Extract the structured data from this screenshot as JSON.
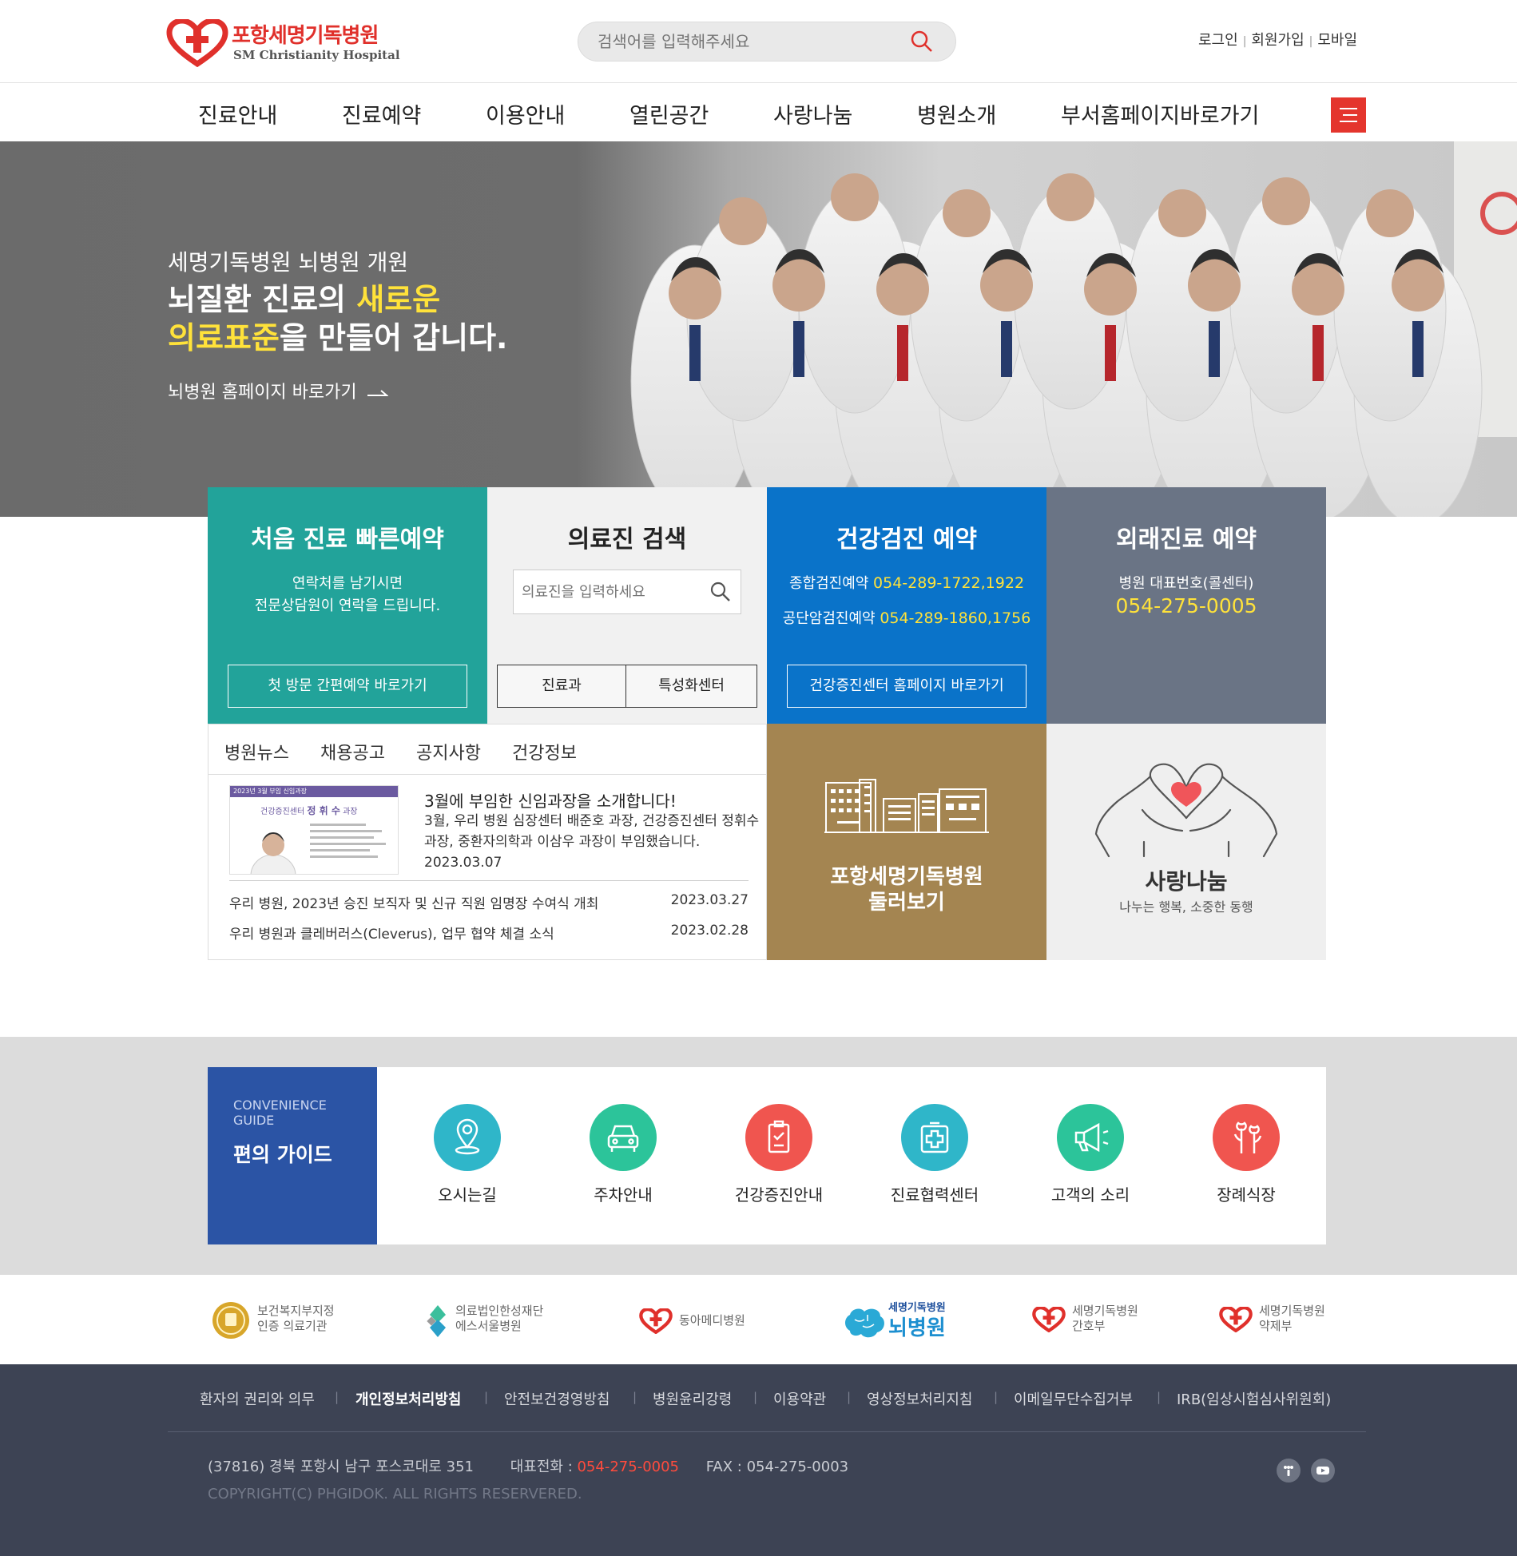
{
  "header": {
    "logo_kr": "포항세명기독병원",
    "logo_en": "SM Christianity Hospital",
    "search_placeholder": "검색어를 입력해주세요",
    "util": [
      "로그인",
      "회원가입",
      "모바일"
    ]
  },
  "nav": {
    "items": [
      "진료안내",
      "진료예약",
      "이용안내",
      "열린공간",
      "사랑나눔",
      "병원소개",
      "부서홈페이지바로가기"
    ]
  },
  "hero": {
    "subtitle": "세명기독병원 뇌병원 개원",
    "line1_a": "뇌질환 진료의 ",
    "line1_hl": "새로운",
    "line2_hl": "의료표준",
    "line2_b": "을 만들어 갑니다.",
    "link": "뇌병원 홈페이지 바로가기"
  },
  "quick": {
    "first_visit": {
      "title": "처음 진료 빠른예약",
      "text1": "연락처를 남기시면",
      "text2": "전문상담원이 연락을 드립니다.",
      "button": "첫 방문 간편예약 바로가기"
    },
    "doctor_search": {
      "title": "의료진 검색",
      "placeholder": "의료진을 입력하세요",
      "tab1": "진료과",
      "tab2": "특성화센터"
    },
    "checkup": {
      "title": "건강검진 예약",
      "row1_label": "종합검진예약 ",
      "row1_num": "054-289-1722,1922",
      "row2_label": "공단암검진예약 ",
      "row2_num": "054-289-1860,1756",
      "button": "건강증진센터 홈페이지 바로가기"
    },
    "outpatient": {
      "title": "외래진료 예약",
      "label": "병원 대표번호(콜센터)",
      "phone": "054-275-0005"
    }
  },
  "news": {
    "tabs": [
      "병원뉴스",
      "채용공고",
      "공지사항",
      "건강정보"
    ],
    "thumb_header": "2023년 3월 부임 신임과장",
    "thumb_dept": "건강증진센터",
    "thumb_name": "정 휘 수",
    "thumb_role": "과장",
    "featured_title": "3월에 부임한 신임과장을 소개합니다!",
    "featured_body": "3월, 우리 병원 심장센터 배준호 과장, 건강증진센터 정휘수 과장, 중환자의학과 이삼우 과장이 부임했습니다.",
    "featured_date": "2023.03.07",
    "rows": [
      {
        "title": "우리 병원, 2023년 승진 보직자 및 신규 직원 임명장 수여식 개최",
        "date": "2023.03.27"
      },
      {
        "title": "우리 병원과 클레버러스(Cleverus), 업무 협약 체결 소식",
        "date": "2023.02.28"
      }
    ]
  },
  "tour": {
    "line1": "포항세명기독병원",
    "line2": "둘러보기"
  },
  "love": {
    "title": "사랑나눔",
    "subtitle": "나누는 행복, 소중한 동행"
  },
  "convenience": {
    "en": "CONVENIENCE GUIDE",
    "en1": "CONVENIENCE",
    "en2": "GUIDE",
    "title": "편의 가이드",
    "items": [
      {
        "label": "오시는길",
        "color": "#2fb6c9",
        "icon": "map-pin-icon"
      },
      {
        "label": "주차안내",
        "color": "#2cc49a",
        "icon": "car-icon"
      },
      {
        "label": "건강증진안내",
        "color": "#f0554f",
        "icon": "checklist-icon"
      },
      {
        "label": "진료협력센터",
        "color": "#2fb6c9",
        "icon": "medical-cross-icon"
      },
      {
        "label": "고객의 소리",
        "color": "#2cc49a",
        "icon": "megaphone-icon"
      },
      {
        "label": "장례식장",
        "color": "#f0554f",
        "icon": "flower-icon"
      }
    ]
  },
  "partners": [
    {
      "l1": "보건복지부지정",
      "l2": "인증 의료기관"
    },
    {
      "l1": "의료법인한성재단",
      "l2": "에스서울병원"
    },
    {
      "l1": "동아메디병원",
      "l2": ""
    },
    {
      "l1": "세명기독병원",
      "l2": "뇌병원"
    },
    {
      "l1": "세명기독병원",
      "l2": "간호부"
    },
    {
      "l1": "세명기독병원",
      "l2": "약제부"
    }
  ],
  "footer": {
    "links": [
      "환자의 권리와 의무",
      "개인정보처리방침",
      "안전보건경영방침",
      "병원윤리강령",
      "이용약관",
      "영상정보처리지침",
      "이메일무단수집거부",
      "IRB(임상시험심사위원회)"
    ],
    "address": "(37816) 경북 포항시 남구 포스코대로 351",
    "tel_label": "대표전화 : ",
    "tel": "054-275-0005",
    "fax": "FAX : 054-275-0003",
    "copyright": "COPYRIGHT(C) PHGIDOK. ALL RIGHTS RESERVERED."
  },
  "colors": {
    "brand_red": "#e0302b",
    "teal": "#22a39a",
    "blue": "#0a73c9",
    "slate": "#6a7485",
    "gold": "#a48551",
    "navy": "#2b54a5",
    "highlight": "#ffe23a"
  }
}
